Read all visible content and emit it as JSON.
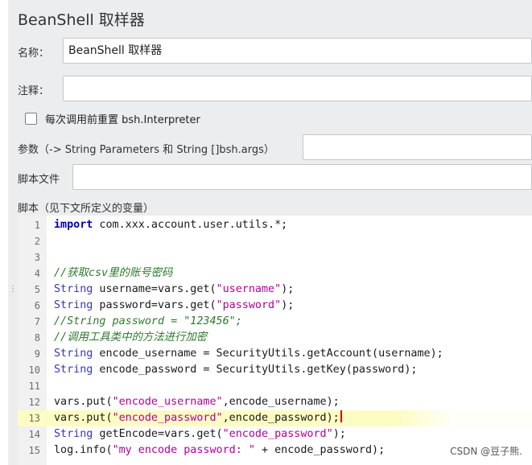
{
  "title": "BeanShell 取样器",
  "name": {
    "label": "名称：",
    "value": "BeanShell 取样器"
  },
  "comment": {
    "label": "注释：",
    "value": ""
  },
  "reset_checkbox": {
    "label": "每次调用前重置 bsh.Interpreter",
    "checked": false
  },
  "params": {
    "label": "参数（-> String Parameters 和 String []bsh.args）",
    "value": ""
  },
  "script_file": {
    "label": "脚本文件",
    "value": ""
  },
  "script": {
    "label": "脚本（见下文所定义的变量）",
    "current_line": 13,
    "lines": [
      {
        "num": "1",
        "text": "import com.xxx.account.user.utils.*;"
      },
      {
        "num": "2",
        "text": ""
      },
      {
        "num": "3",
        "text": ""
      },
      {
        "num": "4",
        "text": "//获取csv里的账号密码"
      },
      {
        "num": "5",
        "text": "String username=vars.get(\"username\");"
      },
      {
        "num": "6",
        "text": "String password=vars.get(\"password\");"
      },
      {
        "num": "7",
        "text": "//String password = \"123456\";"
      },
      {
        "num": "8",
        "text": "//调用工具类中的方法进行加密"
      },
      {
        "num": "9",
        "text": "String encode_username = SecurityUtils.getAccount(username);"
      },
      {
        "num": "10",
        "text": "String encode_password = SecurityUtils.getKey(password);"
      },
      {
        "num": "11",
        "text": ""
      },
      {
        "num": "12",
        "text": "vars.put(\"encode_username\",encode_username);"
      },
      {
        "num": "13",
        "text": "vars.put(\"encode_password\",encode_password);"
      },
      {
        "num": "14",
        "text": "String getEncode=vars.get(\"encode_password\");"
      },
      {
        "num": "15",
        "text": "log.info(\"my encode password: \" + encode_password);"
      }
    ]
  },
  "watermark": "CSDN @豆子熊.",
  "colors": {
    "keyword": "#0000a8",
    "type": "#3a3aa8",
    "string": "#b3009a",
    "comment": "#2d7a2d",
    "current_line_bg": "#fdfcc3",
    "caret": "#e00000"
  }
}
